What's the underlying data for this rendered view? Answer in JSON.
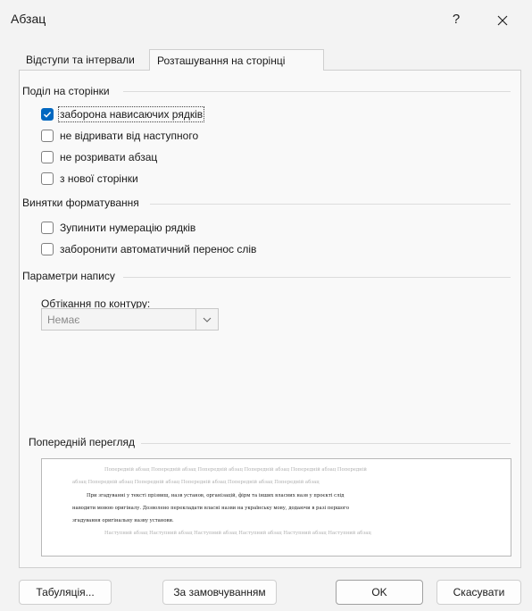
{
  "window": {
    "title": "Абзац",
    "help": "?"
  },
  "tabs": [
    {
      "label": "Відступи та інтервали",
      "active": false
    },
    {
      "label": "Розташування на сторінці",
      "active": true
    }
  ],
  "pagination": {
    "title": "Поділ на сторінки",
    "options": [
      {
        "label": "заборона нависаючих рядків",
        "checked": true
      },
      {
        "label": "не відривати від наступного",
        "checked": false
      },
      {
        "label": "не розривати абзац",
        "checked": false
      },
      {
        "label": "з нової сторінки",
        "checked": false
      }
    ]
  },
  "exceptions": {
    "title": "Винятки форматування",
    "options": [
      {
        "label": "Зупинити нумерацію рядків",
        "checked": false
      },
      {
        "label": "заборонити автоматичний перенос слів",
        "checked": false
      }
    ]
  },
  "textbox": {
    "title": "Параметри напису",
    "wrap_label": "Обтікання по контуру:",
    "wrap_value": "Немає"
  },
  "preview": {
    "title": "Попередній перегляд",
    "prev_line1": "Попередній абзац Попередній абзац Попередній абзац Попередній абзац Попередній абзац Попередній",
    "prev_line2": "абзац Попередній абзац Попередній абзац Попередній абзац Попередній абзац Попередній абзац",
    "main_line1": "При згадуванні у тексті прізвищ, назв установ, організацій, фірм та інших власних назв у проєкті слід",
    "main_line2": "наводити мовою оригіналу. Дозволено перекладати власні назви на українську мову, додаючи в разі першого",
    "main_line3": "згадування оригінальну назву установи.",
    "next_line1": "Наступний абзац Наступний абзац Наступний абзац Наступний абзац Наступний абзац Наступний абзац"
  },
  "buttons": {
    "tabs": "Табуляція...",
    "default": "За замовчуванням",
    "ok": "OK",
    "cancel": "Скасувати"
  },
  "colors": {
    "accent": "#0067c0",
    "background": "#f3f3f3"
  }
}
